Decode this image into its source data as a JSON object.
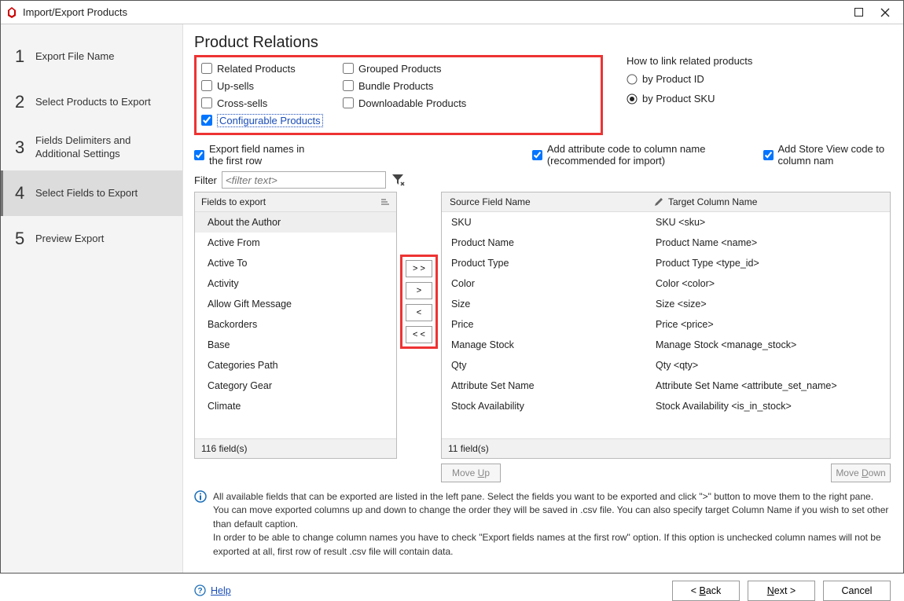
{
  "window": {
    "title": "Import/Export Products"
  },
  "steps": [
    {
      "num": "1",
      "label": "Export File Name"
    },
    {
      "num": "2",
      "label": "Select Products to Export"
    },
    {
      "num": "3",
      "label": "Fields Delimiters and Additional Settings"
    },
    {
      "num": "4",
      "label": "Select Fields to Export"
    },
    {
      "num": "5",
      "label": "Preview Export"
    }
  ],
  "section_title": "Product Relations",
  "relations": {
    "left": [
      "Related Products",
      "Up-sells",
      "Cross-sells",
      "Configurable Products"
    ],
    "right": [
      "Grouped Products",
      "Bundle Products",
      "Downloadable Products"
    ],
    "checked": "Configurable Products"
  },
  "link": {
    "title": "How to link related products",
    "opt1": "by Product ID",
    "opt2": "by Product SKU"
  },
  "opts": {
    "export_names": "Export field names in the  first row",
    "add_attr": "Add attribute code to column name (recommended for import)",
    "add_store": "Add Store View code to column nam"
  },
  "filter": {
    "label": "Filter",
    "placeholder": "<filter text>"
  },
  "fields_list": {
    "header": "Fields to export",
    "items": [
      "About the Author",
      "Active From",
      "Active To",
      "Activity",
      "Allow Gift Message",
      "Backorders",
      "Base",
      "Categories Path",
      "Category Gear",
      "Climate"
    ],
    "footer": "116 field(s)"
  },
  "transfer": {
    "all_right": "> >",
    "right": ">",
    "left": "<",
    "all_left": "< <"
  },
  "selected": {
    "col1": "Source Field Name",
    "col2": "Target Column Name",
    "rows": [
      {
        "src": "SKU",
        "tgt": "SKU <sku>"
      },
      {
        "src": "Product Name",
        "tgt": "Product Name <name>"
      },
      {
        "src": "Product Type",
        "tgt": "Product Type <type_id>"
      },
      {
        "src": "Color",
        "tgt": "Color <color>"
      },
      {
        "src": "Size",
        "tgt": "Size <size>"
      },
      {
        "src": "Price",
        "tgt": "Price <price>"
      },
      {
        "src": "Manage Stock",
        "tgt": "Manage Stock <manage_stock>"
      },
      {
        "src": "Qty",
        "tgt": "Qty <qty>"
      },
      {
        "src": "Attribute Set Name",
        "tgt": "Attribute Set Name <attribute_set_name>"
      },
      {
        "src": "Stock Availability",
        "tgt": "Stock Availability <is_in_stock>"
      }
    ],
    "footer": "11 field(s)"
  },
  "move": {
    "up": "Move Up",
    "down": "Move Down"
  },
  "info": "All available fields that can be exported are listed in the left pane. Select the fields you want to be exported and click \">\" button to move them to the right pane. You can move exported columns up and down to change the order they will be saved in .csv file. You can also specify target Column Name if you wish to set other than default caption.\nIn order to be able to change column names you have to check \"Export fields names at the first row\" option. If this option is unchecked column names will not be exported at all, first row of result .csv file will contain data.",
  "footer": {
    "help": "Help",
    "back": "< Back",
    "next": "Next >",
    "cancel": "Cancel"
  }
}
